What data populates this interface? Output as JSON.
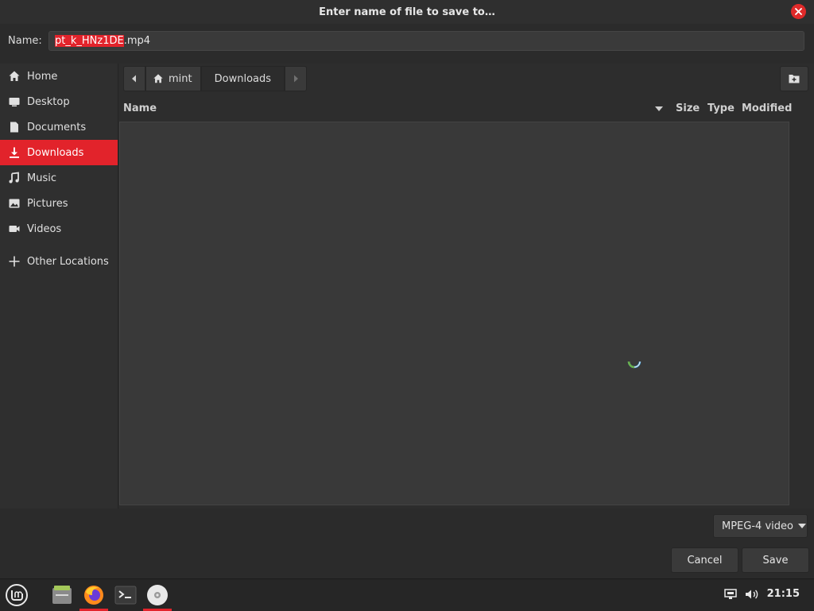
{
  "dialog": {
    "title": "Enter name of file to save to…",
    "close_icon": "close-icon",
    "accent_color": "#e2232b"
  },
  "name_field": {
    "label": "Name:",
    "value_selected": "pt_k_HNz1DE",
    "value_rest": ".mp4"
  },
  "sidebar": {
    "items": [
      {
        "label": "Home",
        "icon": "home-icon"
      },
      {
        "label": "Desktop",
        "icon": "desktop-icon"
      },
      {
        "label": "Documents",
        "icon": "document-icon"
      },
      {
        "label": "Downloads",
        "icon": "download-icon",
        "active": true
      },
      {
        "label": "Music",
        "icon": "music-icon"
      },
      {
        "label": "Pictures",
        "icon": "picture-icon"
      },
      {
        "label": "Videos",
        "icon": "video-icon"
      },
      {
        "label": "Other Locations",
        "icon": "plus-icon"
      }
    ]
  },
  "pathbar": {
    "home_label": "mint",
    "current_label": "Downloads"
  },
  "columns": {
    "name": "Name",
    "size": "Size",
    "type": "Type",
    "modified": "Modified"
  },
  "filter": {
    "selected": "MPEG-4 video"
  },
  "buttons": {
    "cancel": "Cancel",
    "save": "Save"
  },
  "taskbar": {
    "apps": [
      "mint-menu-icon",
      "files-icon",
      "firefox-icon",
      "terminal-icon",
      "disc-icon"
    ],
    "clock": "21:15"
  }
}
